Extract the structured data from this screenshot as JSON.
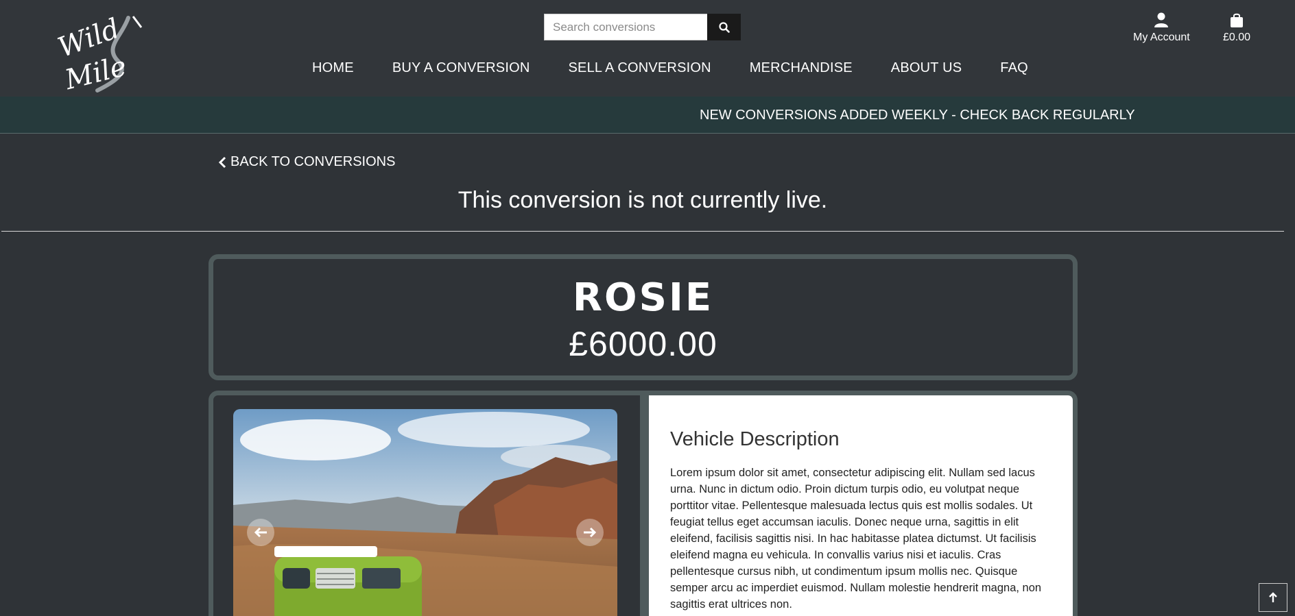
{
  "header": {
    "logo_text": "Wild Mile",
    "search": {
      "placeholder": "Search conversions",
      "value": ""
    },
    "account_label": "My Account",
    "cart_total": "£0.00",
    "nav": [
      "HOME",
      "BUY A CONVERSION",
      "SELL A CONVERSION",
      "MERCHANDISE",
      "ABOUT US",
      "FAQ"
    ]
  },
  "banner": {
    "text": "NEW CONVERSIONS ADDED WEEKLY - CHECK BACK REGULARLY"
  },
  "main": {
    "back_label": "BACK TO CONVERSIONS",
    "status_message": "This conversion is not currently live.",
    "vehicle": {
      "name": "ROSIE",
      "price": "£6000.00"
    },
    "description": {
      "heading": "Vehicle Description",
      "body": "Lorem ipsum dolor sit amet, consectetur adipiscing elit. Nullam sed lacus urna. Nunc in dictum odio. Proin dictum turpis odio, eu volutpat neque porttitor vitae. Pellentesque malesuada lectus quis est mollis sodales. Ut feugiat tellus eget accumsan iaculis. Donec neque urna, sagittis in elit eleifend, facilisis sagittis nisi. In hac habitasse platea dictumst. Ut facilisis eleifend magna eu vehicula. In convallis varius nisi et iaculis. Cras pellentesque cursus nibh, ut condimentum ipsum mollis nec. Quisque semper arcu ac imperdiet euismod. Nullam molestie hendrerit magna, non sagittis erat ultrices non."
    }
  },
  "colors": {
    "page_bg": "#2f3337",
    "banner_bg": "#263a3c",
    "box_border": "#4f5b5c"
  },
  "icons": [
    "search-icon",
    "user-icon",
    "shopping-bag-icon",
    "chevron-left-icon",
    "arrow-left-icon",
    "arrow-right-icon",
    "arrow-up-icon"
  ]
}
